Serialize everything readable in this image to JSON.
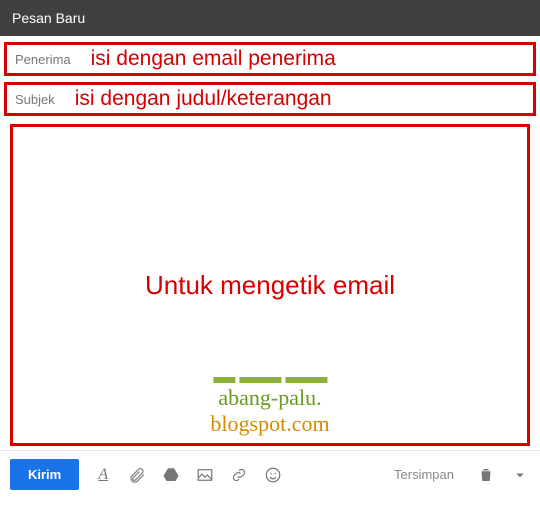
{
  "titlebar": {
    "title": "Pesan Baru"
  },
  "recipients": {
    "label": "Penerima",
    "annotation": "isi dengan email penerima"
  },
  "subject": {
    "label": "Subjek",
    "annotation": "isi dengan judul/keterangan"
  },
  "body": {
    "annotation": "Untuk mengetik email"
  },
  "watermark": {
    "line1": "abang-palu.",
    "line2": "blogspot.com"
  },
  "toolbar": {
    "send_label": "Kirim",
    "saved_label": "Tersimpan"
  }
}
